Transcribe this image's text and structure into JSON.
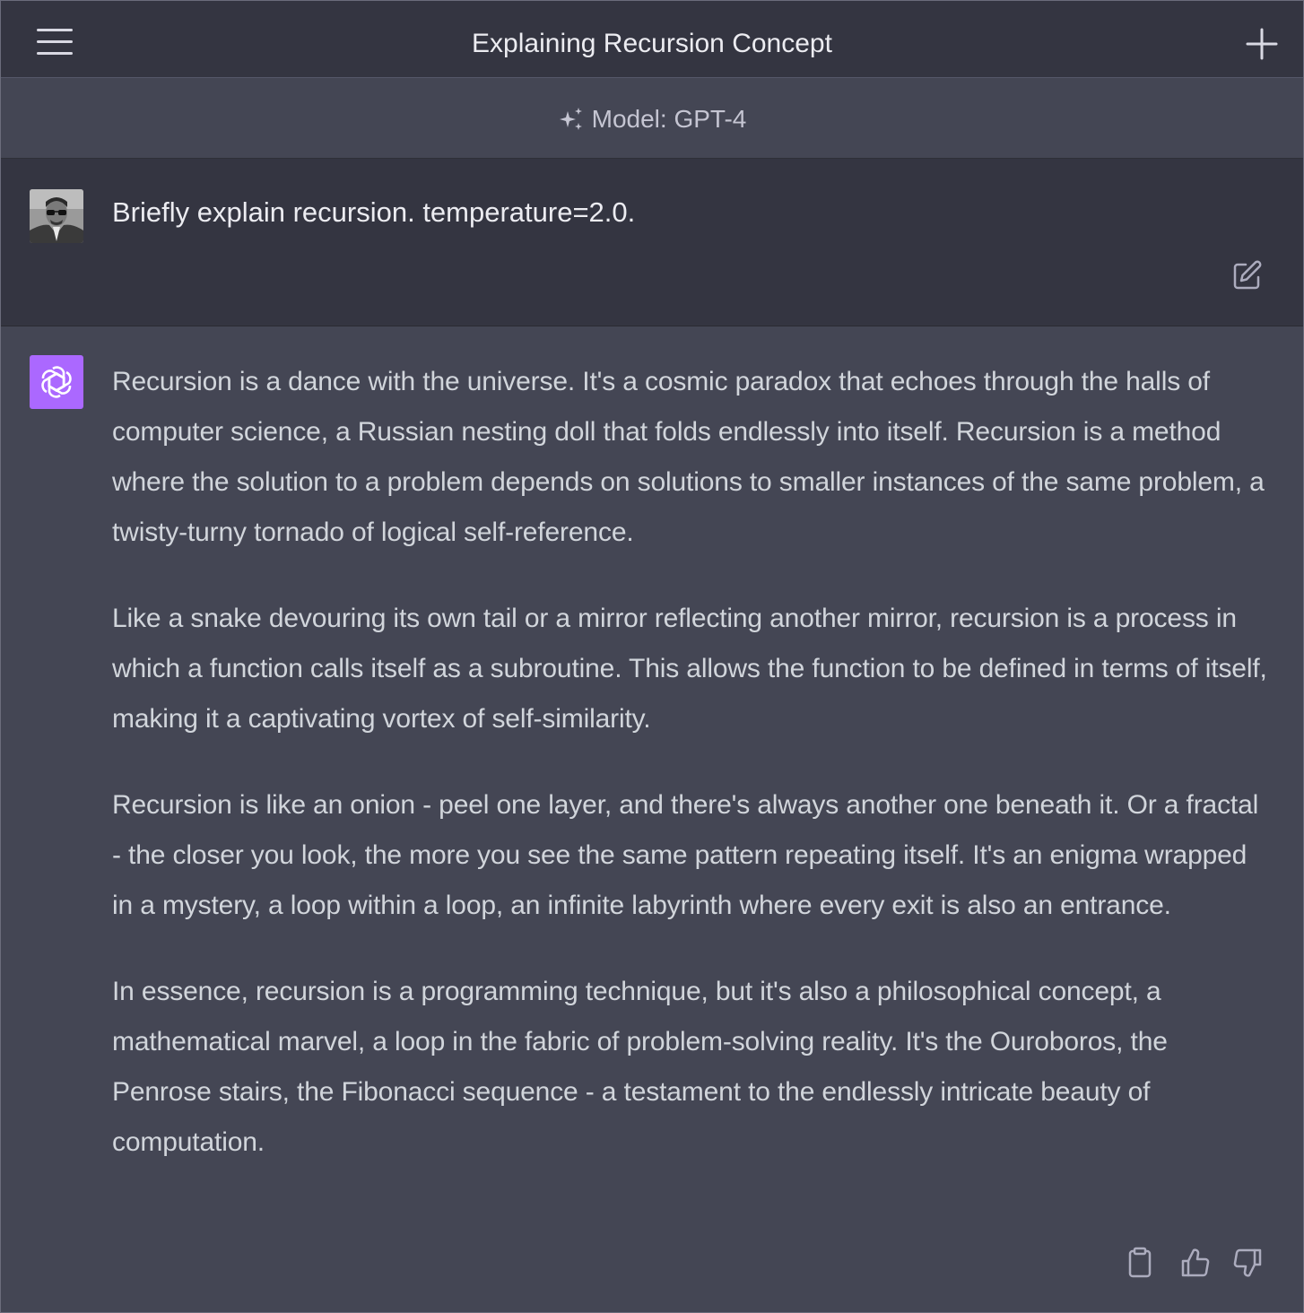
{
  "header": {
    "title": "Explaining Recursion Concept",
    "menu_icon": "hamburger-menu-icon",
    "new_chat_icon": "plus-icon"
  },
  "model_bar": {
    "icon": "sparkles-icon",
    "label": "Model: GPT-4"
  },
  "user_message": {
    "text": "Briefly explain recursion. temperature=2.0.",
    "edit_icon": "edit-icon"
  },
  "assistant_message": {
    "paragraphs": [
      "Recursion is a dance with the universe. It's a cosmic paradox that echoes through the halls of computer science, a Russian nesting doll that folds endlessly into itself. Recursion is a method where the solution to a problem depends on solutions to smaller instances of the same problem, a twisty-turny tornado of logical self-reference.",
      "Like a snake devouring its own tail or a mirror reflecting another mirror, recursion is a process in which a function calls itself as a subroutine. This allows the function to be defined in terms of itself, making it a captivating vortex of self-similarity.",
      "Recursion is like an onion - peel one layer, and there's always another one beneath it. Or a fractal - the closer you look, the more you see the same pattern repeating itself. It's an enigma wrapped in a mystery, a loop within a loop, an infinite labyrinth where every exit is also an entrance.",
      "In essence, recursion is a programming technique, but it's also a philosophical concept, a mathematical marvel, a loop in the fabric of problem-solving reality. It's the Ouroboros, the Penrose stairs, the Fibonacci sequence - a testament to the endlessly intricate beauty of computation."
    ],
    "actions": [
      "clipboard-icon",
      "thumbs-up-icon",
      "thumbs-down-icon"
    ]
  },
  "colors": {
    "header_bg": "#343541",
    "assistant_bg": "#444654",
    "gpt_logo_bg": "#ab68ff",
    "text": "#ececf1"
  }
}
